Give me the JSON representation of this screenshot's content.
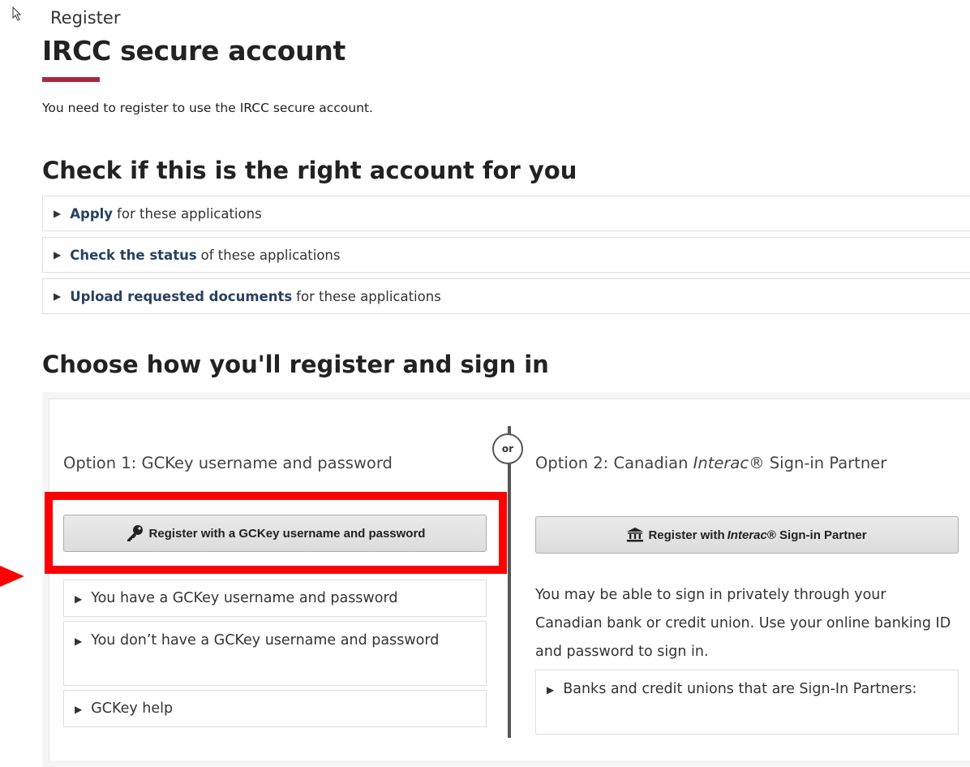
{
  "breadcrumb": "Register",
  "page_title": "IRCC secure account",
  "intro": "You need to register to use the IRCC secure account.",
  "section_check": {
    "heading": "Check if this is the right account for you",
    "items": [
      {
        "bold": "Apply",
        "rest": "for these applications"
      },
      {
        "bold": "Check the status",
        "rest": "of these applications"
      },
      {
        "bold": "Upload requested documents",
        "rest": "for these applications"
      }
    ]
  },
  "section_choose": {
    "heading": "Choose how you'll register and sign in",
    "or_label": "or",
    "option1": {
      "title": "Option 1: GCKey username and password",
      "button": "Register with a GCKey username and password",
      "items": [
        "You have a GCKey username and password",
        "You don’t have a GCKey username and password",
        "GCKey help"
      ]
    },
    "option2": {
      "title_pre": "Option 2: Canadian ",
      "title_em": "Interac",
      "title_post": "® Sign-in Partner",
      "button_pre": "Register with ",
      "button_em": "Interac",
      "button_post": "® Sign-in Partner",
      "description": "You may be able to sign in privately through your Canadian bank or credit union. Use your online banking ID and password to sign in.",
      "items": [
        "Banks and credit unions that are Sign-In Partners:"
      ]
    }
  },
  "annotation": {
    "highlight_color": "#ff0000"
  },
  "icons": {
    "key": "key-icon",
    "bank": "bank-icon",
    "expand": "triangle-right-icon"
  }
}
